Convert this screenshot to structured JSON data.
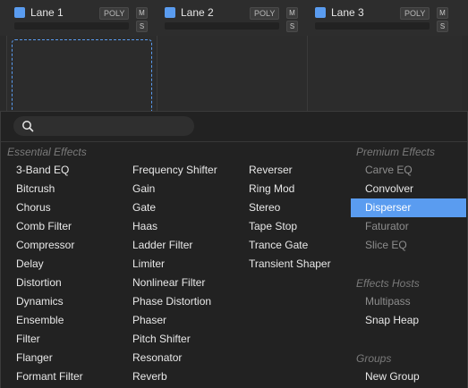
{
  "lanes": [
    {
      "name": "Lane 1",
      "poly": "POLY",
      "m": "M",
      "s": "S"
    },
    {
      "name": "Lane 2",
      "poly": "POLY",
      "m": "M",
      "s": "S"
    },
    {
      "name": "Lane 3",
      "poly": "POLY",
      "m": "M",
      "s": "S"
    }
  ],
  "colors": {
    "accent": "#5a9cf0",
    "panel": "#222222",
    "header": "#2d2d2d"
  },
  "search": {
    "placeholder": ""
  },
  "essential": {
    "title": "Essential Effects",
    "col1": [
      "3-Band EQ",
      "Bitcrush",
      "Chorus",
      "Comb Filter",
      "Compressor",
      "Delay",
      "Distortion",
      "Dynamics",
      "Ensemble",
      "Filter",
      "Flanger",
      "Formant Filter"
    ],
    "col2": [
      "Frequency Shifter",
      "Gain",
      "Gate",
      "Haas",
      "Ladder Filter",
      "Limiter",
      "Nonlinear Filter",
      "Phase Distortion",
      "Phaser",
      "Pitch Shifter",
      "Resonator",
      "Reverb"
    ],
    "col3": [
      "Reverser",
      "Ring Mod",
      "Stereo",
      "Tape Stop",
      "Trance Gate",
      "Transient Shaper"
    ]
  },
  "premium": {
    "title": "Premium Effects",
    "items": [
      "Carve EQ",
      "Convolver",
      "Disperser",
      "Faturator",
      "Slice EQ"
    ],
    "selected": "Disperser"
  },
  "hosts": {
    "title": "Effects Hosts",
    "items": [
      "Multipass",
      "Snap Heap"
    ]
  },
  "groups": {
    "title": "Groups",
    "items": [
      "New Group"
    ]
  }
}
